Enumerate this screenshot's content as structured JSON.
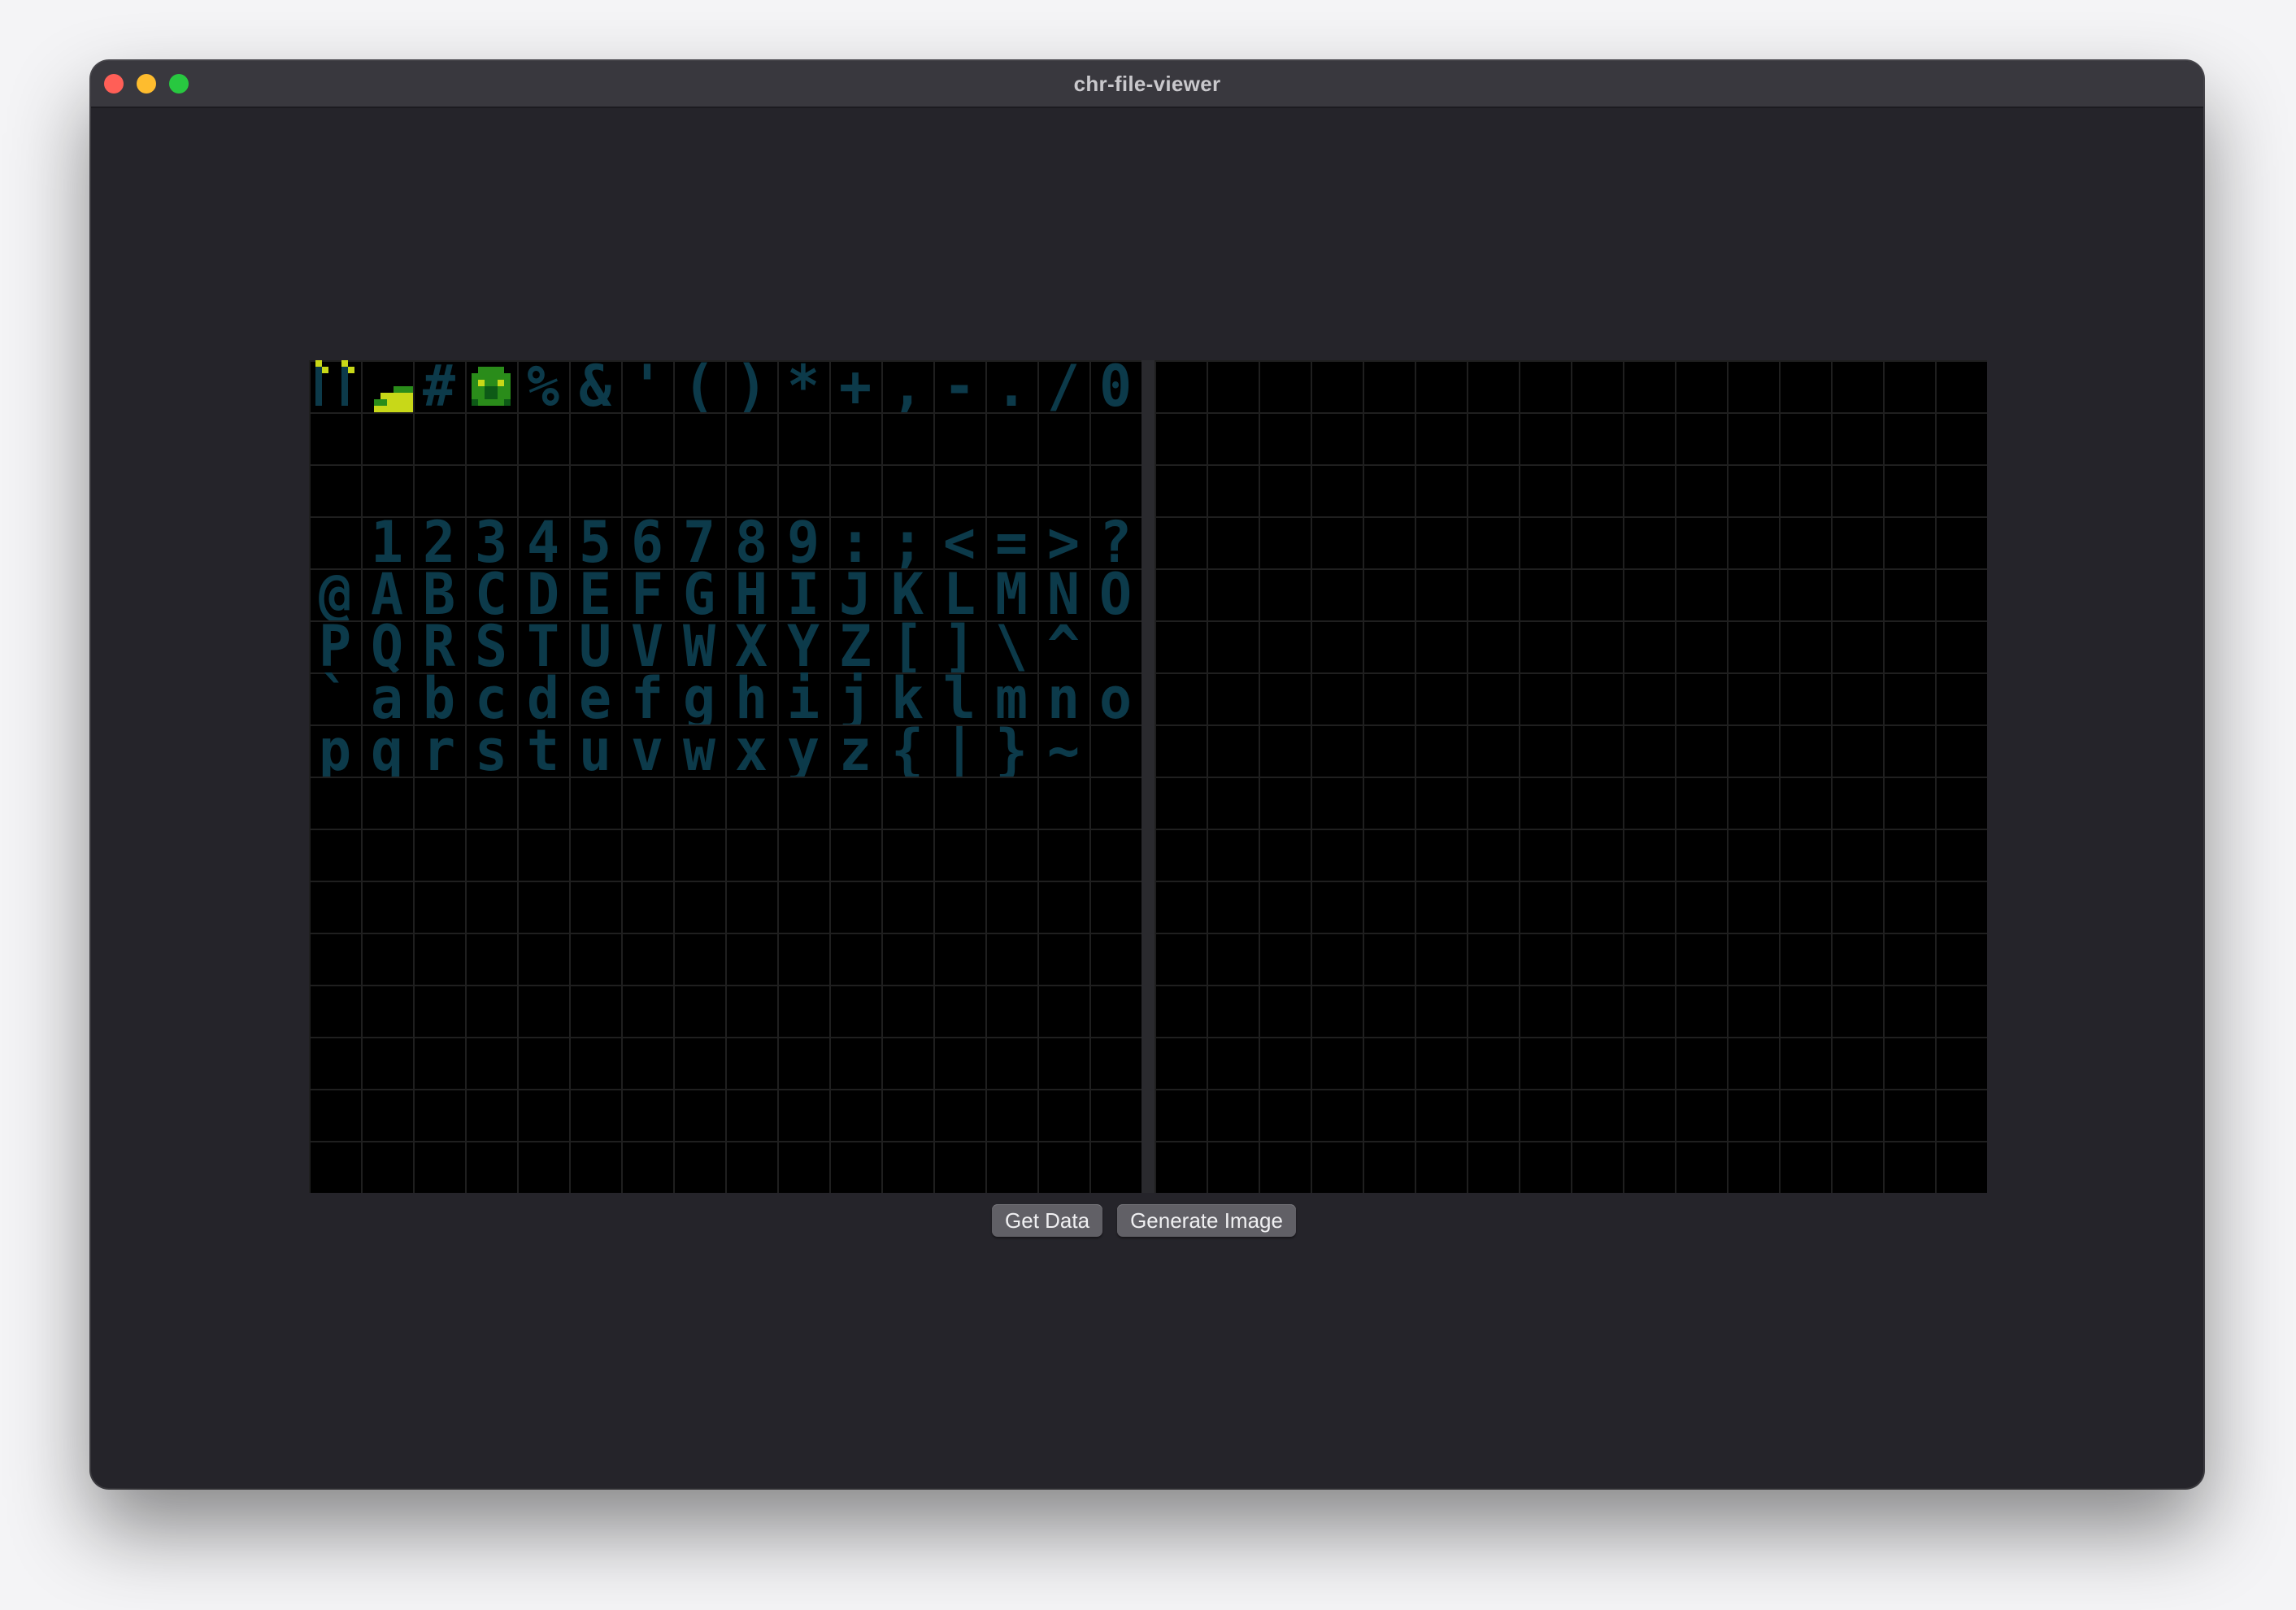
{
  "window": {
    "title": "chr-file-viewer"
  },
  "pattern_table_left": {
    "tiles": [
      {
        "row": 1,
        "col": 3,
        "char": "#"
      },
      {
        "row": 1,
        "col": 5,
        "char": "%"
      },
      {
        "row": 1,
        "col": 6,
        "char": "&"
      },
      {
        "row": 1,
        "col": 7,
        "char": "'"
      },
      {
        "row": 1,
        "col": 8,
        "char": "("
      },
      {
        "row": 1,
        "col": 9,
        "char": ")"
      },
      {
        "row": 1,
        "col": 10,
        "char": "*"
      },
      {
        "row": 1,
        "col": 11,
        "char": "+"
      },
      {
        "row": 1,
        "col": 12,
        "char": ","
      },
      {
        "row": 1,
        "col": 13,
        "char": "-"
      },
      {
        "row": 1,
        "col": 14,
        "char": "."
      },
      {
        "row": 1,
        "col": 15,
        "char": "/"
      },
      {
        "row": 1,
        "col": 16,
        "char": "0"
      },
      {
        "row": 4,
        "col": 2,
        "char": "1"
      },
      {
        "row": 4,
        "col": 3,
        "char": "2"
      },
      {
        "row": 4,
        "col": 4,
        "char": "3"
      },
      {
        "row": 4,
        "col": 5,
        "char": "4"
      },
      {
        "row": 4,
        "col": 6,
        "char": "5"
      },
      {
        "row": 4,
        "col": 7,
        "char": "6"
      },
      {
        "row": 4,
        "col": 8,
        "char": "7"
      },
      {
        "row": 4,
        "col": 9,
        "char": "8"
      },
      {
        "row": 4,
        "col": 10,
        "char": "9"
      },
      {
        "row": 4,
        "col": 11,
        "char": ":"
      },
      {
        "row": 4,
        "col": 12,
        "char": ";"
      },
      {
        "row": 4,
        "col": 13,
        "char": "<"
      },
      {
        "row": 4,
        "col": 14,
        "char": "="
      },
      {
        "row": 4,
        "col": 15,
        "char": ">"
      },
      {
        "row": 4,
        "col": 16,
        "char": "?"
      },
      {
        "row": 5,
        "col": 1,
        "char": "@"
      },
      {
        "row": 5,
        "col": 2,
        "char": "A"
      },
      {
        "row": 5,
        "col": 3,
        "char": "B"
      },
      {
        "row": 5,
        "col": 4,
        "char": "C"
      },
      {
        "row": 5,
        "col": 5,
        "char": "D"
      },
      {
        "row": 5,
        "col": 6,
        "char": "E"
      },
      {
        "row": 5,
        "col": 7,
        "char": "F"
      },
      {
        "row": 5,
        "col": 8,
        "char": "G"
      },
      {
        "row": 5,
        "col": 9,
        "char": "H"
      },
      {
        "row": 5,
        "col": 10,
        "char": "I"
      },
      {
        "row": 5,
        "col": 11,
        "char": "J"
      },
      {
        "row": 5,
        "col": 12,
        "char": "K"
      },
      {
        "row": 5,
        "col": 13,
        "char": "L"
      },
      {
        "row": 5,
        "col": 14,
        "char": "M"
      },
      {
        "row": 5,
        "col": 15,
        "char": "N"
      },
      {
        "row": 5,
        "col": 16,
        "char": "O"
      },
      {
        "row": 6,
        "col": 1,
        "char": "P"
      },
      {
        "row": 6,
        "col": 2,
        "char": "Q"
      },
      {
        "row": 6,
        "col": 3,
        "char": "R"
      },
      {
        "row": 6,
        "col": 4,
        "char": "S"
      },
      {
        "row": 6,
        "col": 5,
        "char": "T"
      },
      {
        "row": 6,
        "col": 6,
        "char": "U"
      },
      {
        "row": 6,
        "col": 7,
        "char": "V"
      },
      {
        "row": 6,
        "col": 8,
        "char": "W"
      },
      {
        "row": 6,
        "col": 9,
        "char": "X"
      },
      {
        "row": 6,
        "col": 10,
        "char": "Y"
      },
      {
        "row": 6,
        "col": 11,
        "char": "Z"
      },
      {
        "row": 6,
        "col": 12,
        "char": "["
      },
      {
        "row": 6,
        "col": 13,
        "char": "]"
      },
      {
        "row": 6,
        "col": 14,
        "char": "\\"
      },
      {
        "row": 6,
        "col": 15,
        "char": "^"
      },
      {
        "row": 6,
        "col": 16,
        "char": "_"
      },
      {
        "row": 7,
        "col": 1,
        "char": "`"
      },
      {
        "row": 7,
        "col": 2,
        "char": "a"
      },
      {
        "row": 7,
        "col": 3,
        "char": "b"
      },
      {
        "row": 7,
        "col": 4,
        "char": "c"
      },
      {
        "row": 7,
        "col": 5,
        "char": "d"
      },
      {
        "row": 7,
        "col": 6,
        "char": "e"
      },
      {
        "row": 7,
        "col": 7,
        "char": "f"
      },
      {
        "row": 7,
        "col": 8,
        "char": "g"
      },
      {
        "row": 7,
        "col": 9,
        "char": "h"
      },
      {
        "row": 7,
        "col": 10,
        "char": "i"
      },
      {
        "row": 7,
        "col": 11,
        "char": "j"
      },
      {
        "row": 7,
        "col": 12,
        "char": "k"
      },
      {
        "row": 7,
        "col": 13,
        "char": "l"
      },
      {
        "row": 7,
        "col": 14,
        "char": "m"
      },
      {
        "row": 7,
        "col": 15,
        "char": "n"
      },
      {
        "row": 7,
        "col": 16,
        "char": "o"
      },
      {
        "row": 8,
        "col": 1,
        "char": "p"
      },
      {
        "row": 8,
        "col": 2,
        "char": "q"
      },
      {
        "row": 8,
        "col": 3,
        "char": "r"
      },
      {
        "row": 8,
        "col": 4,
        "char": "s"
      },
      {
        "row": 8,
        "col": 5,
        "char": "t"
      },
      {
        "row": 8,
        "col": 6,
        "char": "u"
      },
      {
        "row": 8,
        "col": 7,
        "char": "v"
      },
      {
        "row": 8,
        "col": 8,
        "char": "w"
      },
      {
        "row": 8,
        "col": 9,
        "char": "x"
      },
      {
        "row": 8,
        "col": 10,
        "char": "y"
      },
      {
        "row": 8,
        "col": 11,
        "char": "z"
      },
      {
        "row": 8,
        "col": 12,
        "char": "{"
      },
      {
        "row": 8,
        "col": 13,
        "char": "|"
      },
      {
        "row": 8,
        "col": 14,
        "char": "}"
      },
      {
        "row": 8,
        "col": 15,
        "char": "~"
      }
    ],
    "sprites": [
      {
        "row": 1,
        "col": 1,
        "name": "quote-sprite-icon"
      },
      {
        "row": 1,
        "col": 2,
        "name": "slope-sprite-icon"
      },
      {
        "row": 1,
        "col": 4,
        "name": "bug-sprite-icon"
      }
    ],
    "colors": {
      "glyph": "#0c3a4a",
      "yellow": "#c8d818",
      "green": "#2a8c1a",
      "dark_green": "#0d5a16"
    }
  },
  "pattern_table_right": {
    "tiles": []
  },
  "buttons": {
    "get_data": "Get Data",
    "generate_image": "Generate Image"
  }
}
